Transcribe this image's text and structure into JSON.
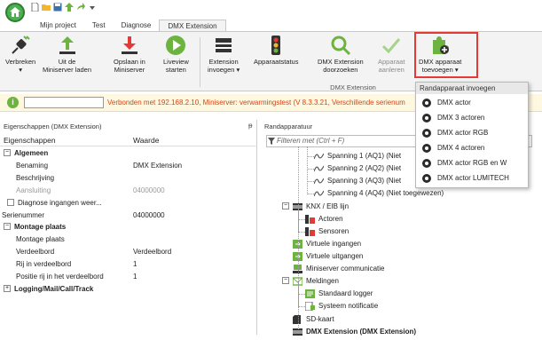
{
  "tabs": [
    "Mijn project",
    "Test",
    "Diagnose",
    "DMX Extension"
  ],
  "ribbon": {
    "buttons": [
      {
        "label": "Verbreken",
        "sub": "▾"
      },
      {
        "label": "Uit de",
        "sub": "Miniserver laden"
      },
      {
        "label": "Opslaan in",
        "sub": "Miniserver"
      },
      {
        "label": "Liveview",
        "sub": "starten"
      },
      {
        "label": "Extension",
        "sub": "invoegen ▾"
      },
      {
        "label": "Apparaatstatus",
        "sub": ""
      },
      {
        "label": "DMX Extension",
        "sub": "doorzoeken"
      },
      {
        "label": "Apparaat",
        "sub": "aanleren"
      },
      {
        "label": "DMX apparaat",
        "sub": "toevoegen ▾"
      }
    ],
    "group_label": "DMX Extension"
  },
  "status": {
    "text": "Verbonden met 192.168.2.10, Miniserver: verwarmingstest (V 8.3.3.21, Verschillende serienum"
  },
  "left_pane": {
    "title": "Eigenschappen (DMX Extension)",
    "pin": "ᵽ",
    "col_key": "Eigenschappen",
    "col_val": "Waarde",
    "rows": [
      {
        "k": "Algemeen",
        "v": "",
        "cat": true,
        "pm": "⊟"
      },
      {
        "k": "Benaming",
        "v": "DMX Extension"
      },
      {
        "k": "Beschrijving",
        "v": ""
      },
      {
        "k": "Aansluiting",
        "v": "04000000",
        "grey": true
      },
      {
        "k": "Diagnose ingangen weer...",
        "v": "",
        "checkbox": true
      },
      {
        "k": "Serienummer",
        "v": "04000000"
      },
      {
        "k": "Montage plaats",
        "v": "",
        "cat": true,
        "pm": "⊟"
      },
      {
        "k": "Montage plaats",
        "v": ""
      },
      {
        "k": "Verdeelbord",
        "v": "Verdeelbord"
      },
      {
        "k": "Rij in verdeelbord",
        "v": "1"
      },
      {
        "k": "Positie rij in het verdeelbord",
        "v": "1"
      },
      {
        "k": "Logging/Mail/Call/Track",
        "v": "",
        "cat": true,
        "pm": "⊞"
      }
    ]
  },
  "right_pane": {
    "title": "Randapparatuur",
    "filter_placeholder": "Filteren met (Ctrl + F)",
    "tree": [
      {
        "label": "Spanning 1 (AQ1) (Niet",
        "icon": "wave-icon"
      },
      {
        "label": "Spanning 2 (AQ2) (Niet",
        "icon": "wave-icon"
      },
      {
        "label": "Spanning 3 (AQ3) (Niet",
        "icon": "wave-icon"
      },
      {
        "label": "Spanning 4 (AQ4) (Niet toegewezen)",
        "icon": "wave-icon"
      },
      {
        "label": "KNX / EIB lijn",
        "icon": "knx-icon"
      },
      {
        "label": "Actoren",
        "icon": "actuator-icon"
      },
      {
        "label": "Sensoren",
        "icon": "sensor-icon"
      },
      {
        "label": "Virtuele ingangen",
        "icon": "virtual-input-icon"
      },
      {
        "label": "Virtuele uitgangen",
        "icon": "virtual-output-icon"
      },
      {
        "label": "Miniserver communicatie",
        "icon": "network-icon"
      },
      {
        "label": "Meldingen",
        "icon": "notification-icon"
      },
      {
        "label": "Standaard logger",
        "icon": "logger-icon"
      },
      {
        "label": "Systeem notificatie",
        "icon": "system-notification-icon"
      },
      {
        "label": "SD-kaart",
        "icon": "sd-card-icon"
      },
      {
        "label": "DMX Extension (DMX Extension)",
        "icon": "dmx-extension-icon"
      }
    ]
  },
  "dropdown": {
    "header": "Randapparaat invoegen",
    "items": [
      "DMX actor",
      "DMX 3 actoren",
      "DMX actor RGB",
      "DMX 4 actoren",
      "DMX actor RGB en W",
      "DMX actor LUMITECH"
    ]
  }
}
